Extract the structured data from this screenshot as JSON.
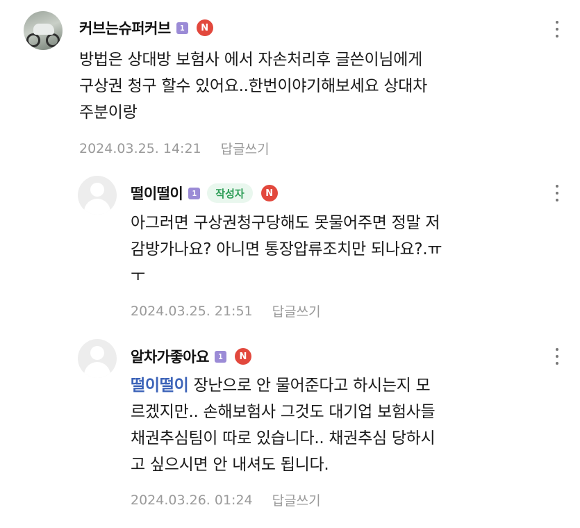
{
  "comments": [
    {
      "nickname": "커브는슈퍼커브",
      "level": "1",
      "n_badge": "N",
      "author_badge": "",
      "lines": [
        "방법은 상대방 보험사 에서 자손처리후 글쓴이님에게",
        "구상권 청구 할수 있어요..한번이야기해보세요 상대차",
        "주분이랑"
      ],
      "mention": "",
      "timestamp": "2024.03.25. 14:21",
      "reply_label": "답글쓰기",
      "avatar": "photo"
    },
    {
      "nickname": "떨이떨이",
      "level": "1",
      "n_badge": "N",
      "author_badge": "작성자",
      "lines": [
        "아그러면 구상권청구당해도 못물어주면 정말 저",
        "감방가나요? 아니면 통장압류조치만 되나요?.ㅠ",
        "ㅜ"
      ],
      "mention": "",
      "timestamp": "2024.03.25. 21:51",
      "reply_label": "답글쓰기",
      "avatar": "default"
    },
    {
      "nickname": "알차가좋아요",
      "level": "1",
      "n_badge": "N",
      "author_badge": "",
      "mention": "떨이떨이",
      "first_line_rest": " 장난으로 안 물어준다고 하시는지 모",
      "lines": [
        "르겠지만.. 손해보험사 그것도 대기업 보험사들",
        "채권추심팀이 따로 있습니다.. 채권추심 당하시",
        "고 싶으시면 안 내셔도 됩니다."
      ],
      "timestamp": "2024.03.26. 01:24",
      "reply_label": "답글쓰기",
      "avatar": "default"
    }
  ],
  "icons": {
    "more": "more-vertical-icon"
  },
  "colors": {
    "n_badge": "#e2483d",
    "level_badge": "#9b8bd6",
    "author_badge_text": "#2f9e58",
    "mention": "#3c63b8"
  }
}
